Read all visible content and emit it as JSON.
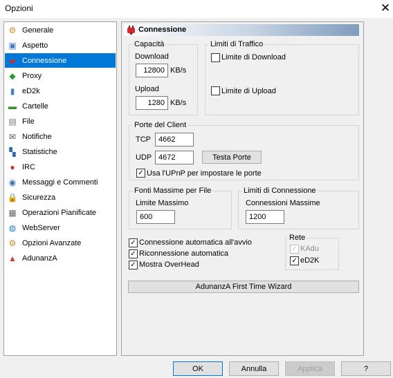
{
  "window": {
    "title": "Opzioni",
    "close_symbol": "✕"
  },
  "sidebar": {
    "items": [
      {
        "label": "Generale",
        "icon": "gear-icon",
        "glyph": "⚙",
        "color": "#e08a1c"
      },
      {
        "label": "Aspetto",
        "icon": "appearance-icon",
        "glyph": "▣",
        "color": "#3b7bd6"
      },
      {
        "label": "Connessione",
        "icon": "plug-icon",
        "glyph": "▰",
        "color": "#d02a2a",
        "selected": true
      },
      {
        "label": "Proxy",
        "icon": "proxy-icon",
        "glyph": "◆",
        "color": "#2f9a2f"
      },
      {
        "label": "eD2k",
        "icon": "ed2k-icon",
        "glyph": "▮",
        "color": "#4a7fc4"
      },
      {
        "label": "Cartelle",
        "icon": "folder-icon",
        "glyph": "▬",
        "color": "#3a8f2e"
      },
      {
        "label": "File",
        "icon": "file-icon",
        "glyph": "▤",
        "color": "#777777"
      },
      {
        "label": "Notifiche",
        "icon": "notification-icon",
        "glyph": "✉",
        "color": "#555555"
      },
      {
        "label": "Statistiche",
        "icon": "statistics-icon",
        "glyph": "▚",
        "color": "#2a6db0"
      },
      {
        "label": "IRC",
        "icon": "irc-icon",
        "glyph": "●",
        "color": "#cc3333"
      },
      {
        "label": "Messaggi e Commenti",
        "icon": "messages-icon",
        "glyph": "◉",
        "color": "#3b6fb6"
      },
      {
        "label": "Sicurezza",
        "icon": "lock-icon",
        "glyph": "🔒",
        "color": "#d6a21c"
      },
      {
        "label": "Operazioni Pianificate",
        "icon": "calendar-icon",
        "glyph": "▦",
        "color": "#666666"
      },
      {
        "label": "WebServer",
        "icon": "globe-icon",
        "glyph": "◍",
        "color": "#1c7fc0"
      },
      {
        "label": "Opzioni Avanzate",
        "icon": "advanced-gear-icon",
        "glyph": "⚙",
        "color": "#d08a1c"
      },
      {
        "label": "AdunanzA",
        "icon": "adunanza-icon",
        "glyph": "▲",
        "color": "#d0382a"
      }
    ]
  },
  "panel": {
    "title": "Connessione",
    "capacita": {
      "label": "Capacità",
      "download_label": "Download",
      "download_value": "12800",
      "download_unit": "KB/s",
      "upload_label": "Upload",
      "upload_value": "1280",
      "upload_unit": "KB/s"
    },
    "limiti_traffico": {
      "label": "Limiti di Traffico",
      "limite_download": {
        "label": "Limite di Download",
        "checked": false
      },
      "limite_upload": {
        "label": "Limite di Upload",
        "checked": false
      }
    },
    "porte": {
      "label": "Porte del Client",
      "tcp_label": "TCP",
      "tcp_value": "4662",
      "udp_label": "UDP",
      "udp_value": "4672",
      "test_button": "Testa Porte",
      "upnp": {
        "label": "Usa l'UPnP per impostare le porte",
        "checked": true
      }
    },
    "fonti": {
      "label": "Fonti Massime per File",
      "sub_label": "Limite Massimo",
      "value": "600"
    },
    "limiti_connessione": {
      "label": "Limiti di Connessione",
      "sub_label": "Connessioni Massime",
      "value": "1200"
    },
    "options": [
      {
        "label": "Connessione automatica all'avvio",
        "checked": true
      },
      {
        "label": "Riconnessione automatica",
        "checked": true
      },
      {
        "label": "Mostra OverHead",
        "checked": true
      }
    ],
    "rete": {
      "label": "Rete",
      "kadu": {
        "label": "KAdu",
        "checked": true,
        "disabled": true
      },
      "ed2k": {
        "label": "eD2K",
        "checked": true
      }
    },
    "wizard_button": "AdunanzA First Time Wizard"
  },
  "footer": {
    "ok": "OK",
    "annulla": "Annulla",
    "applica": "Applica",
    "help": "?"
  }
}
